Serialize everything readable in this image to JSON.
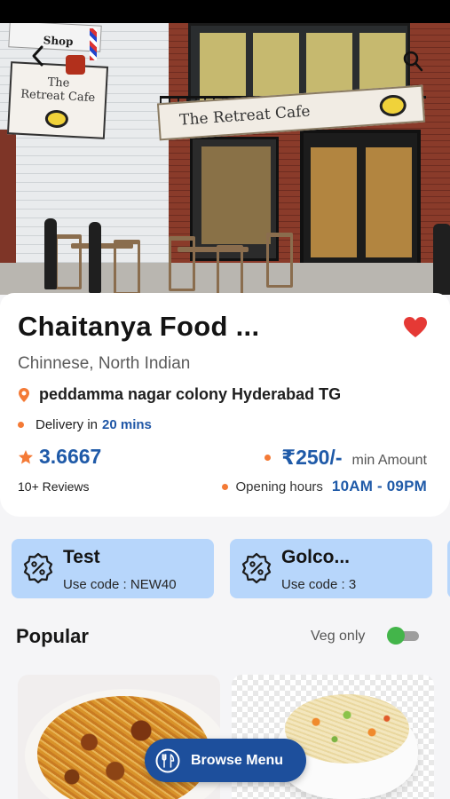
{
  "colors": {
    "accent": "#1f5aa8",
    "heart": "#e53935",
    "location": "#f47a36",
    "offer_background": "#b7d6fb",
    "veg_toggle": "#43b54a",
    "browse_button": "#1d4f9c"
  },
  "header": {
    "back_icon": "chevron-left-icon",
    "search_icon": "search-icon",
    "photo": {
      "sign_main": "The Retreat Cafe",
      "sign_small": [
        "The",
        "Retreat Cafe"
      ],
      "shop_sign": "Shop"
    }
  },
  "restaurant": {
    "name": "Chaitanya Food ...",
    "favorite_icon": "heart-icon",
    "cuisine": "Chinnese, North Indian",
    "address_icon": "location-pin-icon",
    "address": "peddamma nagar colony Hyderabad TG",
    "delivery_label": "Delivery in",
    "delivery_time": "20 mins",
    "rating_icon": "star-icon",
    "rating": "3.6667",
    "reviews": "10+ Reviews",
    "price": "₹250/-",
    "price_label": "min Amount",
    "hours_label": "Opening hours",
    "hours_value": "10AM - 09PM"
  },
  "offers": [
    {
      "icon": "discount-badge-icon",
      "title": "Test",
      "code_label": "Use code :",
      "code": "NEW40"
    },
    {
      "icon": "discount-badge-icon",
      "title": "Golco...",
      "code_label": "Use code :",
      "code": "3"
    }
  ],
  "popular": {
    "title": "Popular",
    "veg_label": "Veg only",
    "veg_only": true
  },
  "browse": {
    "icon": "fork-knife-icon",
    "label": "Browse Menu"
  }
}
